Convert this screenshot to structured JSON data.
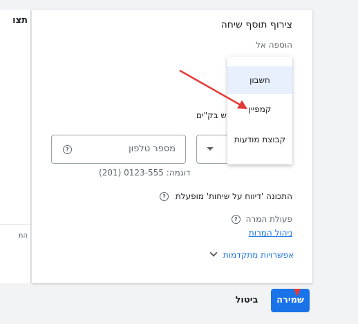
{
  "left_panel": {
    "title": "תצו",
    "small_text": "הת"
  },
  "dialog": {
    "title": "צירוף תוסף שיחה",
    "add_to_label": "הוספה אל",
    "partial_label": "מוש בק\"ים",
    "phone": {
      "label": "מספר טלפון",
      "example": "דוגמה: 0123-555 (201)"
    },
    "feature": {
      "text": "התכונה 'דיווח על שיחות' מופעלת"
    },
    "conversion": {
      "label": "פעולת המרה",
      "manage_link": "ניהול המרות"
    },
    "advanced": {
      "label": "אפשרויות מתקדמות"
    }
  },
  "dropdown": {
    "items": [
      {
        "label": "חשבון",
        "selected": true
      },
      {
        "label": "קמפיין",
        "selected": false
      },
      {
        "label": "קבוצת מודעות",
        "selected": false
      }
    ]
  },
  "buttons": {
    "cancel": "ביטול",
    "save": "שמירה"
  },
  "colors": {
    "accent": "#1a73e8",
    "annotation": "#e53935"
  },
  "icons": {
    "help": "help-circle-icon",
    "chevron": "chevron-down-icon",
    "select_arrow": "caret-down-icon"
  }
}
